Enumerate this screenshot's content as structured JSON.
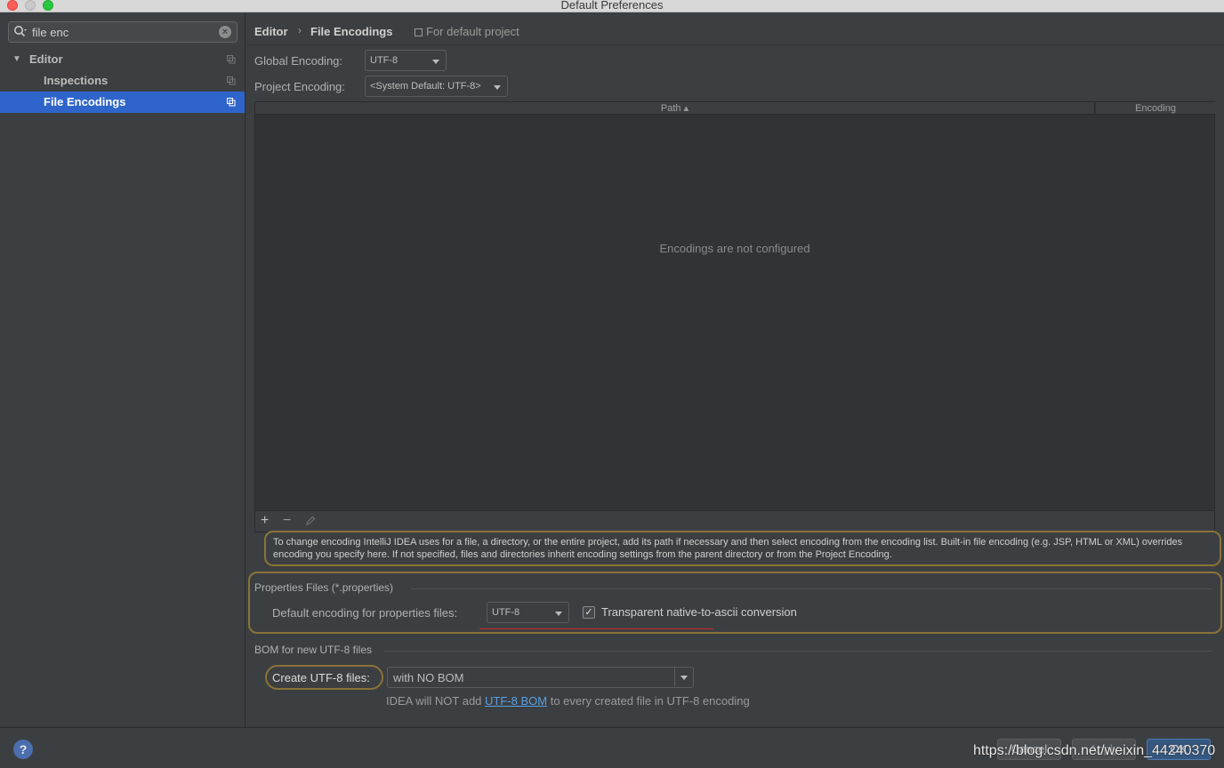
{
  "window": {
    "title": "Default Preferences"
  },
  "search": {
    "value": "file enc",
    "placeholder": ""
  },
  "tree": {
    "items": [
      {
        "label": "Editor"
      },
      {
        "label": "Inspections"
      },
      {
        "label": "File Encodings"
      }
    ]
  },
  "header": {
    "crumb1": "Editor",
    "crumb2": "File Encodings",
    "scope": "For default project"
  },
  "global_encoding": {
    "label": "Global Encoding:",
    "value": "UTF-8"
  },
  "project_encoding": {
    "label": "Project Encoding:",
    "value": "<System Default: UTF-8>"
  },
  "table": {
    "headers": [
      "Path ▴",
      "Encoding"
    ],
    "empty": "Encodings are not configured"
  },
  "info_text": "To change encoding IntelliJ IDEA uses for a file, a directory, or the entire project, add its path if necessary and then select encoding from the encoding list. Built-in file encoding (e.g. JSP, HTML or XML) overrides encoding you specify here. If not specified, files and directories inherit encoding settings from the parent directory or from the Project Encoding.",
  "properties": {
    "title": "Properties Files (*.properties)",
    "label": "Default encoding for properties files:",
    "value": "UTF-8",
    "checkbox_label": "Transparent native-to-ascii conversion",
    "checked": true
  },
  "bom": {
    "title": "BOM for new UTF-8 files",
    "label": "Create UTF-8 files:",
    "value": "with NO BOM",
    "hint_prefix": "IDEA will NOT add ",
    "hint_link": "UTF-8 BOM",
    "hint_suffix": " to every created file in UTF-8 encoding"
  },
  "buttons": {
    "cancel": "Cancel",
    "apply": "Apply",
    "ok": "OK"
  },
  "watermark": "https://blog.csdn.net/weixin_44240370"
}
